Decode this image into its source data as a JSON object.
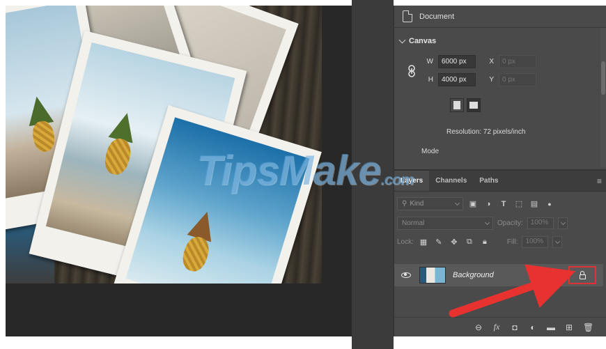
{
  "properties": {
    "header_title": "Document",
    "section_title": "Canvas",
    "width_label": "W",
    "width_value": "6000 px",
    "height_label": "H",
    "height_value": "4000 px",
    "x_label": "X",
    "x_placeholder": "0 px",
    "y_label": "Y",
    "y_placeholder": "0 px",
    "resolution": "Resolution: 72 pixels/inch",
    "mode_label": "Mode"
  },
  "layers": {
    "tabs": [
      {
        "label": "Layers",
        "active": true
      },
      {
        "label": "Channels",
        "active": false
      },
      {
        "label": "Paths",
        "active": false
      }
    ],
    "filter_label": "Kind",
    "blend_mode": "Normal",
    "opacity_label": "Opacity:",
    "opacity_value": "100%",
    "lock_label": "Lock:",
    "fill_label": "Fill:",
    "fill_value": "100%",
    "layer_name": "Background"
  },
  "watermark": {
    "text": "TipsMake",
    "suffix": ".com"
  },
  "colors": {
    "panel_bg": "#4a4a4a",
    "workspace_bg": "#282828",
    "highlight_red": "#e03232"
  }
}
